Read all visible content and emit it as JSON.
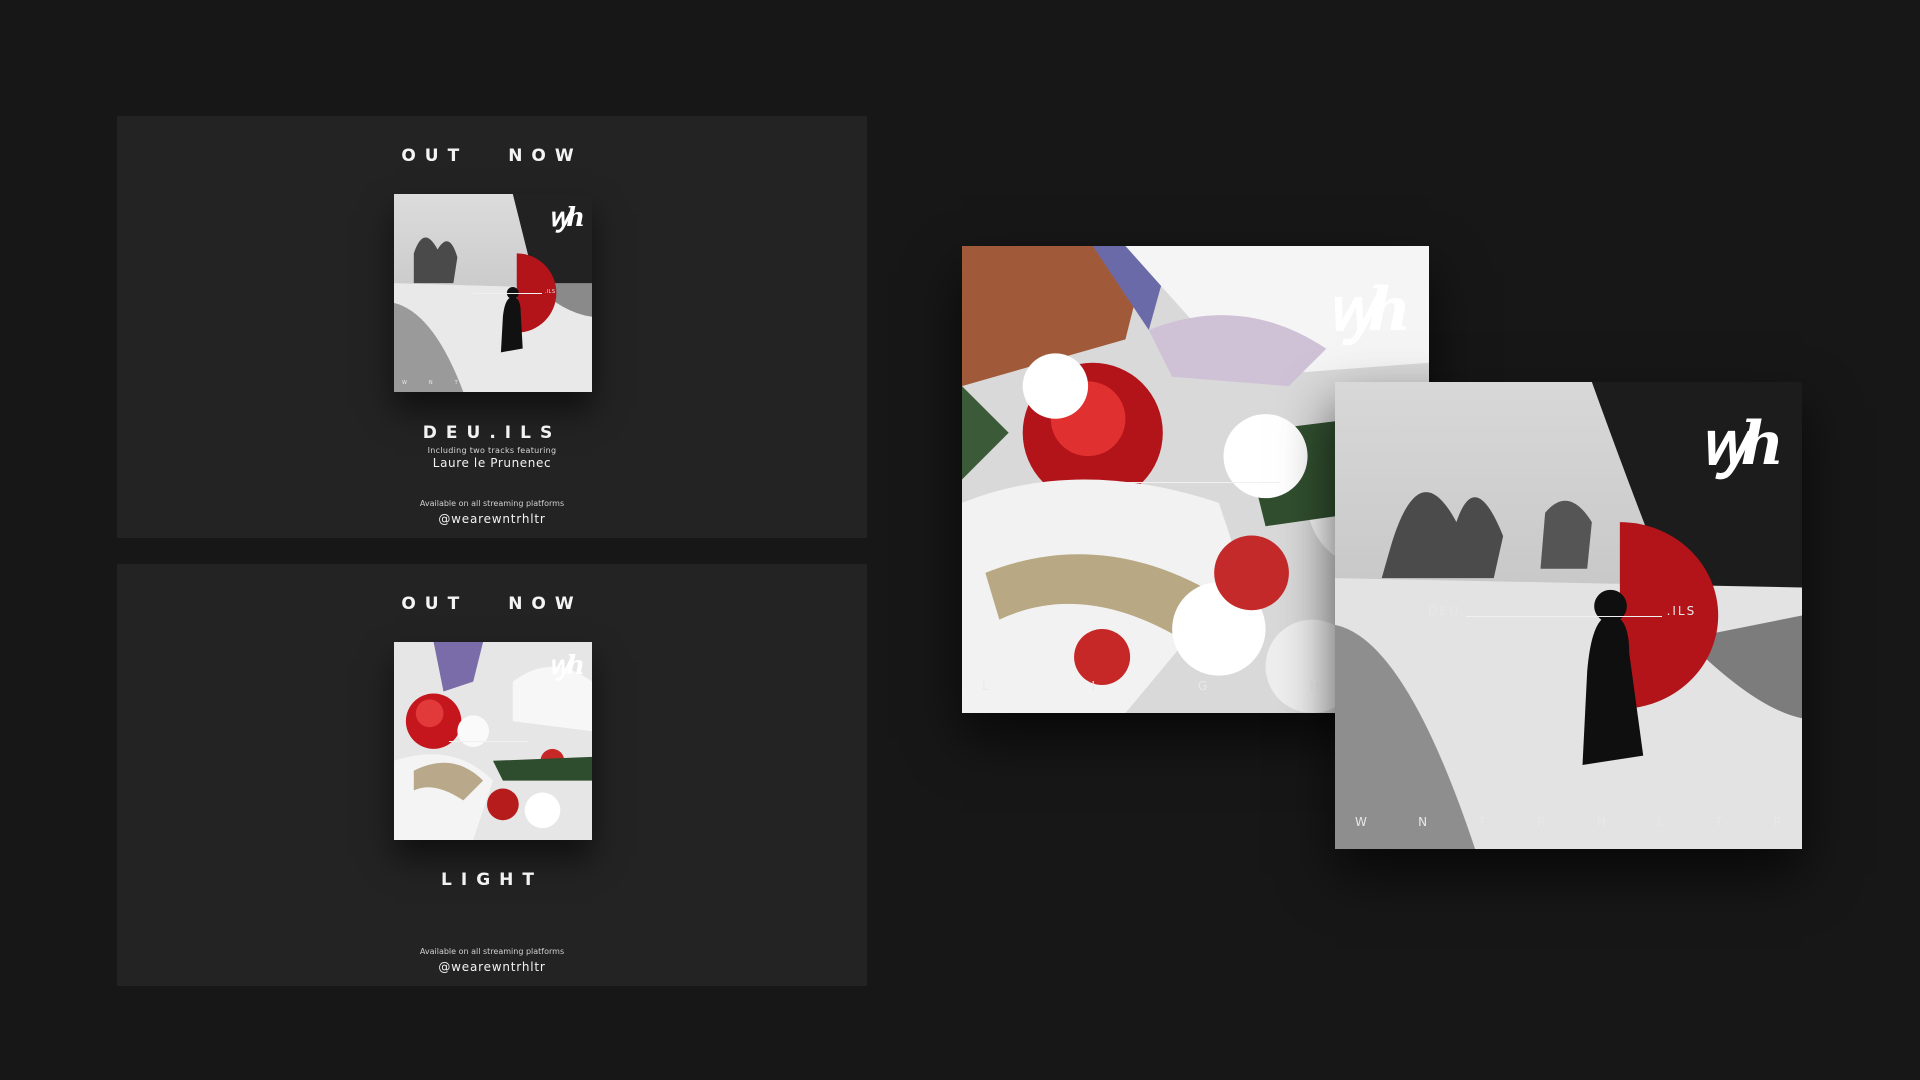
{
  "brand": {
    "logo_text": "ꝡh",
    "palette": {
      "background": "#171717",
      "panel": "#232323",
      "accent": "#b3141a"
    }
  },
  "promo_deuils": {
    "heading_left": "OUT",
    "heading_right": "NOW",
    "album": "DEU.ILS",
    "featuring_line": "Including two tracks featuring",
    "featuring_name": "Laure le Prunenec",
    "availability": "Available on all streaming platforms",
    "handle": "@wearewntrhltr"
  },
  "promo_light": {
    "heading_left": "OUT",
    "heading_right": "NOW",
    "album": "LIGHT",
    "availability": "Available on all streaming platforms",
    "handle": "@wearewntrhltr"
  },
  "cover_light": {
    "letters": [
      "L",
      "I",
      "G",
      "H"
    ]
  },
  "cover_deuils": {
    "left_label": "DEU",
    "right_label": ".ILS",
    "letters": [
      "W",
      "N",
      "T",
      "R",
      "H",
      "L",
      "T",
      "R"
    ]
  }
}
